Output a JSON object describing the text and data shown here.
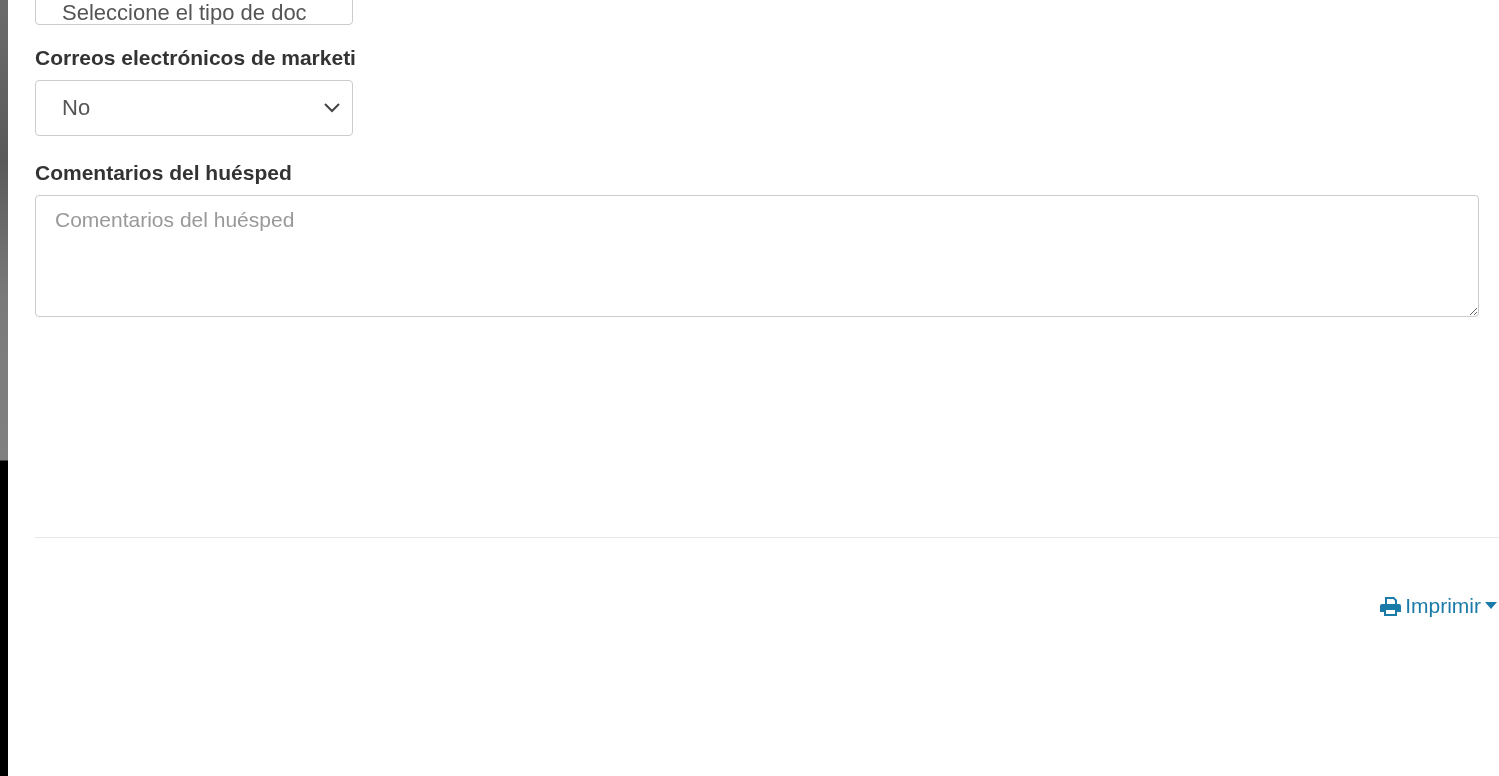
{
  "document_type_select": {
    "value": "Seleccione el tipo de doc"
  },
  "marketing_emails": {
    "label": "Correos electrónicos de marketi",
    "value": "No"
  },
  "guest_comments": {
    "label": "Comentarios del huésped",
    "placeholder": "Comentarios del huésped"
  },
  "print_menu": {
    "label": "Imprimir"
  }
}
